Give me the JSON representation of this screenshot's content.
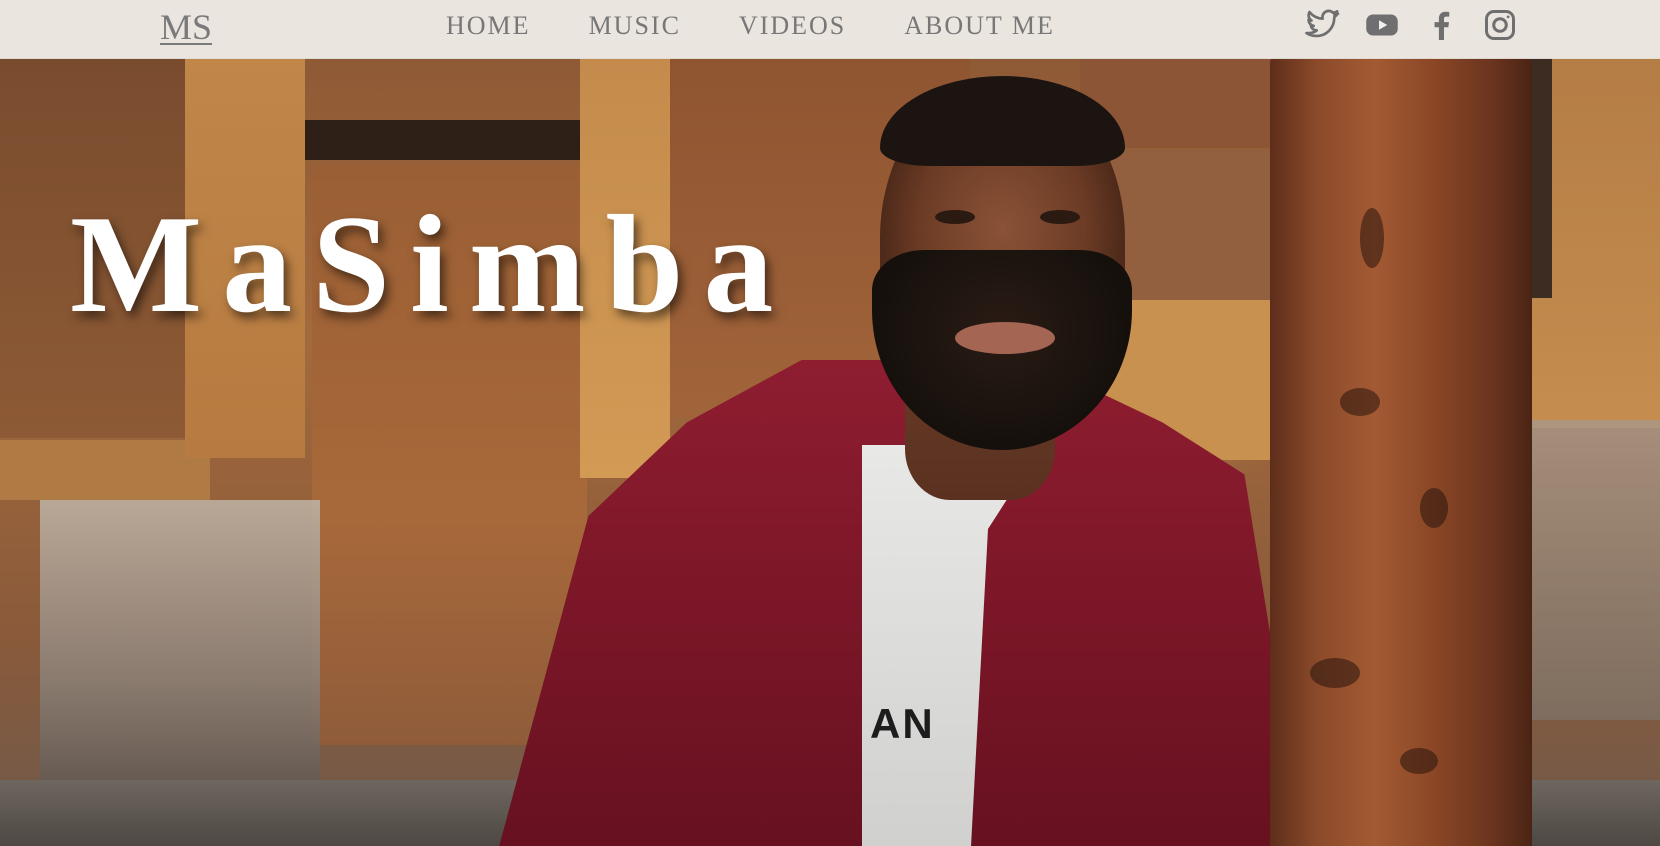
{
  "nav": {
    "logo": "MS",
    "links": [
      {
        "label": "HOME"
      },
      {
        "label": "MUSIC"
      },
      {
        "label": "VIDEOS"
      },
      {
        "label": "ABOUT ME"
      }
    ],
    "social": [
      {
        "icon": "twitter-icon"
      },
      {
        "icon": "youtube-icon"
      },
      {
        "icon": "facebook-icon"
      },
      {
        "icon": "instagram-icon"
      }
    ]
  },
  "hero": {
    "title": "MaSimba",
    "shirt_print": "AN"
  },
  "colors": {
    "nav_bg": "#f2f0ee",
    "nav_text": "#777777",
    "title": "#ffffff",
    "jacket": "#8e1d30"
  }
}
